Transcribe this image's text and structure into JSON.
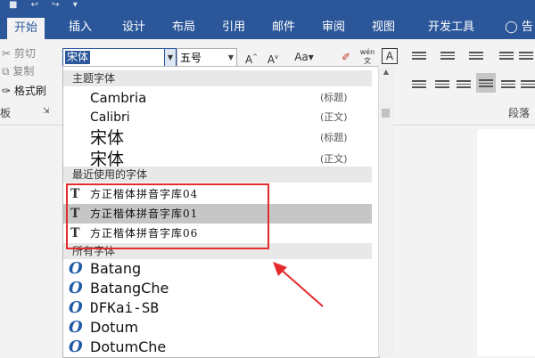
{
  "ribbon": {
    "tabs": [
      "开始",
      "插入",
      "设计",
      "布局",
      "引用",
      "邮件",
      "审阅",
      "视图",
      "开发工具",
      "告"
    ],
    "clipboard": {
      "cut": "剪切",
      "copy": "复制",
      "format_painter": "格式刷",
      "group_label": "板"
    },
    "font": {
      "current_font": "宋体",
      "current_size": "五号",
      "aa_label": "Aa",
      "wen_label": "wén",
      "a_box": "A"
    },
    "paragraph_label": "段落"
  },
  "font_dropdown": {
    "theme_header": "主题字体",
    "theme_fonts": [
      {
        "name": "Cambria",
        "tag": "(标题)"
      },
      {
        "name": "Calibri",
        "tag": "(正文)"
      },
      {
        "name": "宋体",
        "tag": "(标题)"
      },
      {
        "name": "宋体",
        "tag": "(正文)"
      }
    ],
    "recent_header": "最近使用的字体",
    "recent_fonts": [
      "方正楷体拼音字库04",
      "方正楷体拼音字库01",
      "方正楷体拼音字库06"
    ],
    "all_header": "所有字体",
    "all_fonts": [
      "Batang",
      "BatangChe",
      "DFKai-SB",
      "Dotum",
      "DotumChe"
    ]
  },
  "colors": {
    "accent": "#2b579a",
    "highlight_border": "#e52b2b"
  }
}
